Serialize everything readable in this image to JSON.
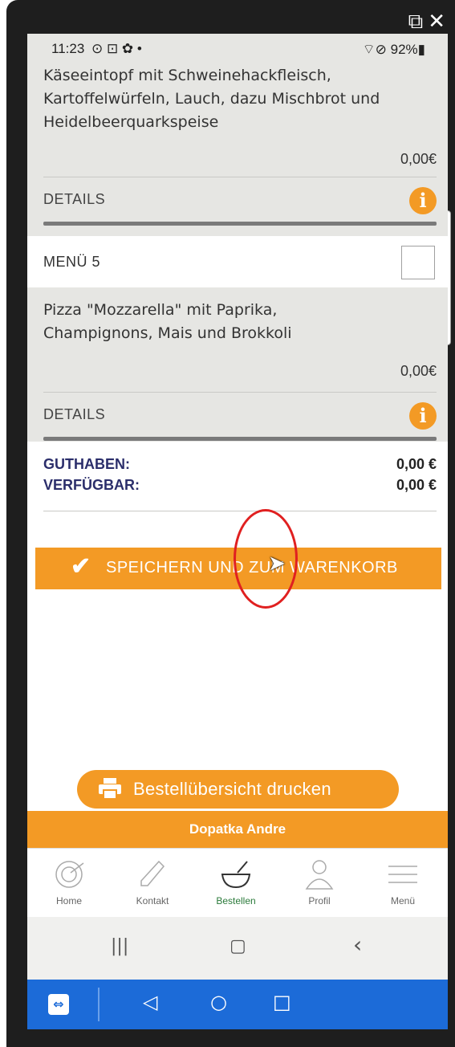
{
  "window_controls": {
    "popout": "⧉",
    "close": "✕"
  },
  "status_bar": {
    "time": "11:23",
    "status_icons": "⊙ ⊡ ✿ •",
    "right": "⌔⊘ 92%▮"
  },
  "menu4": {
    "description_lines": [
      "Käseeintopf mit Schweinehackfleisch,",
      "Kartoffelwürfeln, Lauch, dazu Mischbrot und",
      "Heidelbeerquarkspeise"
    ],
    "price": "0,00€",
    "details_label": "DETAILS"
  },
  "menu5": {
    "title": "MENÜ 5",
    "description_lines": [
      "Pizza \"Mozzarella\" mit Paprika,",
      "Champignons, Mais und Brokkoli"
    ],
    "price": "0,00€",
    "details_label": "DETAILS"
  },
  "balance": {
    "guthaben_label": "GUTHABEN:",
    "guthaben_value": "0,00 €",
    "verfuegbar_label": "VERFÜGBAR:",
    "verfuegbar_value": "0,00 €"
  },
  "save_button": {
    "label": "SPEICHERN UND ZUM WARENKORB"
  },
  "print_button": {
    "label": "Bestellübersicht drucken"
  },
  "user_bar": {
    "name": "Dopatka Andre"
  },
  "tabs": [
    {
      "label": "Home",
      "icon": "plate-icon"
    },
    {
      "label": "Kontakt",
      "icon": "phone-icon"
    },
    {
      "label": "Bestellen",
      "icon": "bowl-icon",
      "active": true
    },
    {
      "label": "Profil",
      "icon": "person-icon"
    },
    {
      "label": "Menü",
      "icon": "hamburger-icon"
    }
  ],
  "android_nav": {
    "recents": "|||",
    "home": "▢",
    "back": "‹"
  },
  "teamviewer_bar": {
    "logo": "⇔",
    "back": "◁",
    "home": "○",
    "recents": "□"
  },
  "colors": {
    "accent": "#f39a25",
    "navy": "#2b2e6b",
    "active_tab": "#2a7a3a",
    "teamviewer_blue": "#1c6bd8"
  }
}
